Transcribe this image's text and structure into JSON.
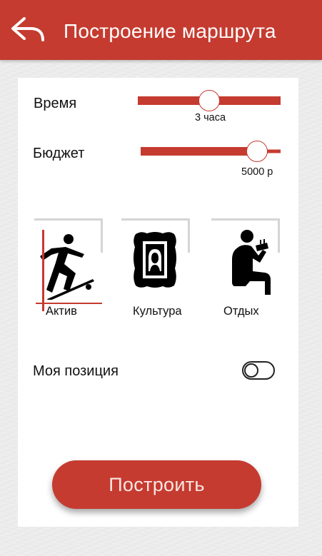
{
  "header": {
    "title": "Построение маршрута",
    "back_icon": "back-arrow-icon"
  },
  "filters": {
    "time": {
      "label": "Время",
      "value_text": "3 часа",
      "level": 0.5
    },
    "budget": {
      "label": "Бюджет",
      "value_text": "5000 р",
      "level": 0.83
    }
  },
  "categories": [
    {
      "label": "Актив",
      "icon": "skateboarder-icon",
      "selected": true
    },
    {
      "label": "Культура",
      "icon": "portrait-frame-icon",
      "selected": false
    },
    {
      "label": "Отдых",
      "icon": "sitting-person-icon",
      "selected": false
    }
  ],
  "position_toggle": {
    "label": "Моя позиция",
    "enabled": false
  },
  "build_button": {
    "label": "Построить"
  },
  "colors": {
    "accent": "#c53b30",
    "background": "#eeeeee",
    "card": "#ffffff",
    "text": "#111111"
  }
}
